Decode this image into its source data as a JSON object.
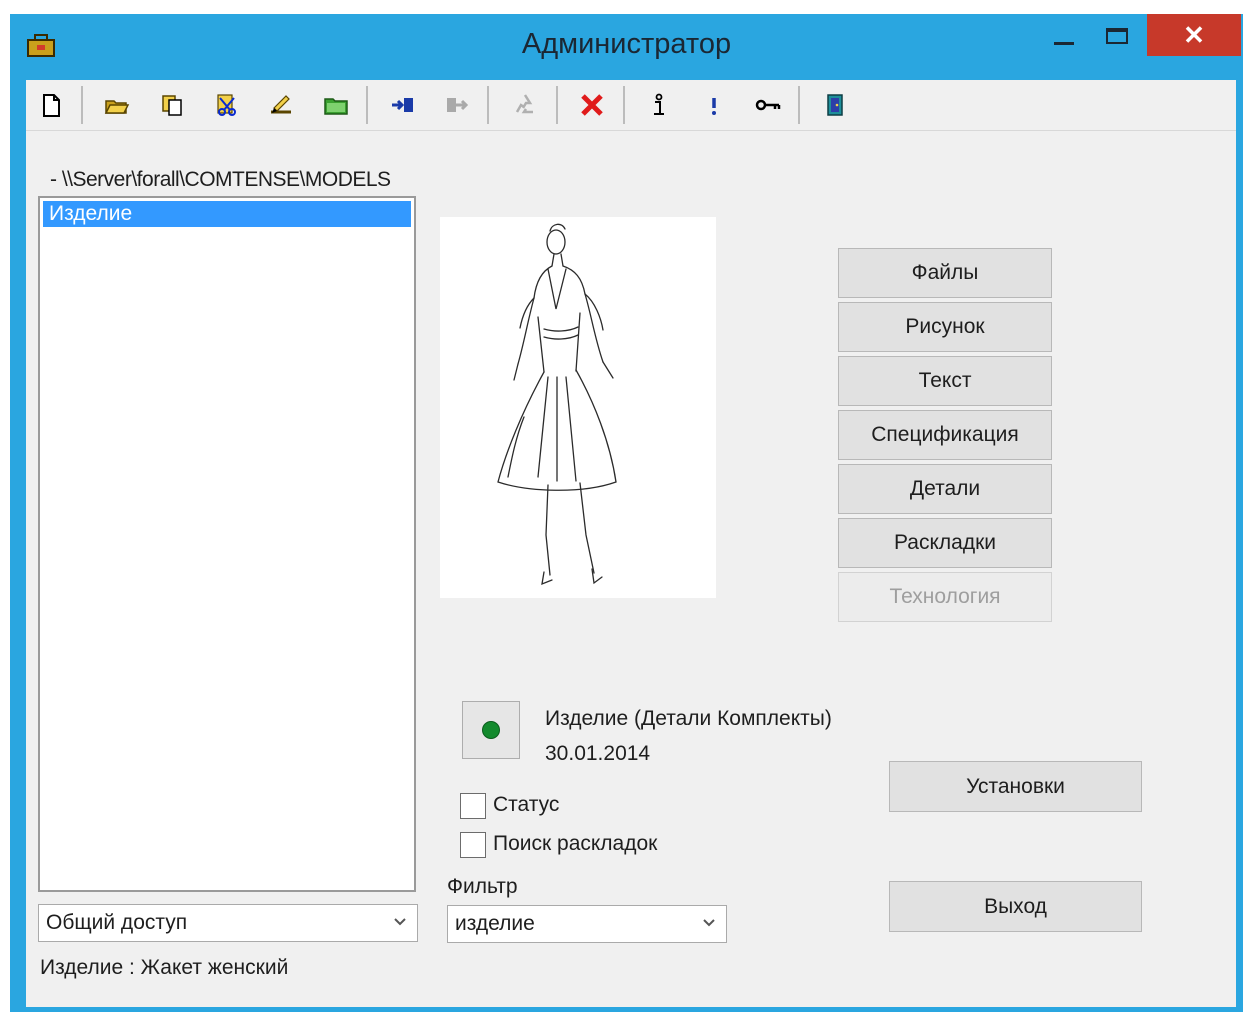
{
  "window": {
    "title": "Администратор",
    "close_glyph": "✕"
  },
  "toolbar": {
    "buttons": [
      {
        "name": "new-icon"
      },
      {
        "name": "open-icon"
      },
      {
        "name": "copy-icon"
      },
      {
        "name": "cut-icon"
      },
      {
        "name": "edit-icon"
      },
      {
        "name": "folder-icon"
      },
      {
        "name": "import-icon"
      },
      {
        "name": "export-icon"
      },
      {
        "name": "recycle-icon"
      },
      {
        "name": "delete-icon"
      },
      {
        "name": "info-icon"
      },
      {
        "name": "exclamation-icon"
      },
      {
        "name": "key-icon"
      },
      {
        "name": "exit-door-icon"
      }
    ]
  },
  "path": "- \\\\Server\\forall\\COMTENSE\\MODELS",
  "tree": {
    "items": [
      "Изделие"
    ]
  },
  "access_select": {
    "value": "Общий доступ"
  },
  "status_line": "Изделие : Жакет женский",
  "side_buttons": {
    "files": "Файлы",
    "drawing": "Рисунок",
    "text": "Текст",
    "specification": "Спецификация",
    "details": "Детали",
    "layouts": "Раскладки",
    "technology": "Технология"
  },
  "product": {
    "title": "Изделие (Детали Комплекты)",
    "date": "30.01.2014",
    "indicator_color": "#138a2d"
  },
  "checkboxes": {
    "status": "Статус",
    "search_layouts": "Поиск раскладок"
  },
  "filter": {
    "label": "Фильтр",
    "value": "изделие"
  },
  "actions": {
    "settings": "Установки",
    "exit": "Выход"
  },
  "colors": {
    "frame": "#2aa6e0",
    "selection": "#3399ff",
    "close": "#c7392a"
  }
}
